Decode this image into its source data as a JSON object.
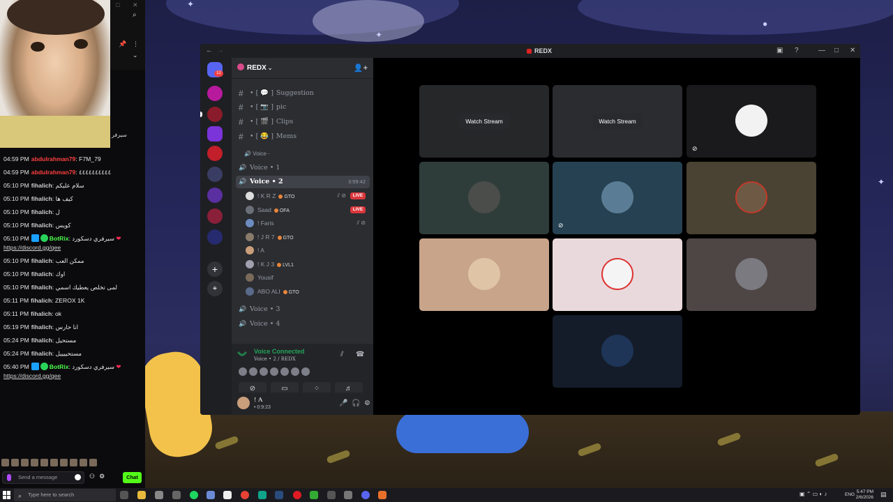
{
  "discord": {
    "window_title": "REDX",
    "server_name": "REDX",
    "text_channels": [
      {
        "name": "Suggestion",
        "prefix": "• [ 💬 ]"
      },
      {
        "name": "pic",
        "prefix": "• [ 📷 ]"
      },
      {
        "name": "Clips",
        "prefix": "• [ 🎬 ]"
      },
      {
        "name": "Mems",
        "prefix": "• [ 😂 ]"
      }
    ],
    "category": "Voice··",
    "voice_channels": [
      {
        "name": "Voice • 1"
      },
      {
        "name": "Voice • 2",
        "timer": "3:59:42"
      },
      {
        "name": "Voice • 3"
      },
      {
        "name": "Voice • 4"
      }
    ],
    "members": [
      {
        "name": "! K R Z",
        "tag": "GTO",
        "live": "LIVE"
      },
      {
        "name": "Saad",
        "tag": "OFA",
        "live": "LIVE"
      },
      {
        "name": "! Faris",
        "tag": ""
      },
      {
        "name": "! J R 7",
        "tag": "GTO"
      },
      {
        "name": "! A",
        "tag": ""
      },
      {
        "name": "! K J 3",
        "tag": "LVL1"
      },
      {
        "name": "Yousif",
        "tag": ""
      },
      {
        "name": "ABO ALI",
        "tag": "GTO"
      }
    ],
    "voice_panel": {
      "status": "Voice Connected",
      "location": "Voice • 2 / REDX"
    },
    "user": {
      "name": "! A",
      "status": "• 0:9:23"
    },
    "stage": {
      "watch_stream_label": "Watch Stream"
    }
  },
  "chat": {
    "messages": [
      {
        "time": "04:59 PM",
        "user": "abdulrahman79",
        "user_color": "red",
        "text": ": F7M_79"
      },
      {
        "time": "04:59 PM",
        "user": "abdulrahman79",
        "user_color": "red",
        "text": ": ٤٤٤٤٤٤٤٤٤٤"
      },
      {
        "time": "05:10 PM",
        "user": "fihalich",
        "user_color": "normal",
        "text": ": سلام عليكم"
      },
      {
        "time": "05:10 PM",
        "user": "fihalich",
        "user_color": "normal",
        "text": ": كيف ها"
      },
      {
        "time": "05:10 PM",
        "user": "fihalich",
        "user_color": "normal",
        "text": ": ل"
      },
      {
        "time": "05:10 PM",
        "user": "fihalich",
        "user_color": "normal",
        "text": ": كويس"
      },
      {
        "time": "05:10 PM",
        "user": "BotRix",
        "user_color": "green",
        "text": ": سيرفري دسكورد",
        "badges": true,
        "link": "https://discord.gg/qee"
      },
      {
        "time": "05:10 PM",
        "user": "fihalich",
        "user_color": "normal",
        "text": ": ممكن العب"
      },
      {
        "time": "05:10 PM",
        "user": "fihalich",
        "user_color": "normal",
        "text": ": اوك"
      },
      {
        "time": "05:10 PM",
        "user": "fihalich",
        "user_color": "normal",
        "text": ": لمى تخلص يعطيك اسمي"
      },
      {
        "time": "05:11 PM",
        "user": "fihalich",
        "user_color": "normal",
        "text": ": ZEROX 1K"
      },
      {
        "time": "05:11 PM",
        "user": "fihalich",
        "user_color": "normal",
        "text": ": ok"
      },
      {
        "time": "05:19 PM",
        "user": "fihalich",
        "user_color": "normal",
        "text": ": انا حارس"
      },
      {
        "time": "05:24 PM",
        "user": "fihalich",
        "user_color": "normal",
        "text": ": مستحيل"
      },
      {
        "time": "05:24 PM",
        "user": "fihalich",
        "user_color": "normal",
        "text": ": مستحييييل"
      },
      {
        "time": "05:40 PM",
        "user": "BotRix",
        "user_color": "green",
        "text": ": سيرفري دسكورد",
        "badges": true,
        "link": "https://discord.gg/qee"
      }
    ],
    "input_placeholder": "Send a message",
    "chat_button": "Chat",
    "webcam_caption": "سيرفر"
  },
  "taskbar": {
    "search_placeholder": "Type here to search",
    "language": "ENG",
    "time": "5:47 PM",
    "date": "2/6/2026"
  },
  "colors": {
    "live_red": "#da373c",
    "connected_green": "#23a55a",
    "kick_green": "#53fc18"
  }
}
